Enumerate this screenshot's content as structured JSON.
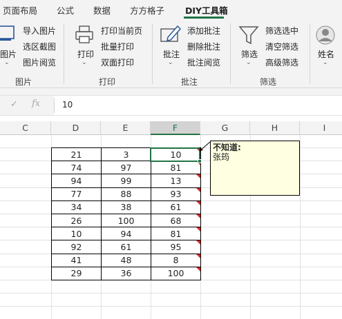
{
  "tabs": [
    {
      "label": "页面布局"
    },
    {
      "label": "公式"
    },
    {
      "label": "数据"
    },
    {
      "label": "方方格子"
    },
    {
      "label": "DIY工具箱",
      "active": true
    }
  ],
  "ribbon": {
    "picture_group": {
      "big_button": "图片",
      "items": [
        "导入图片",
        "选区截图",
        "图片阅览"
      ],
      "label": "图片"
    },
    "print_group": {
      "big_button": "打印",
      "items": [
        "打印当前页",
        "批量打印",
        "双面打印"
      ],
      "label": "打印"
    },
    "comment_group": {
      "big_button": "批注",
      "items": [
        "添加批注",
        "删除批注",
        "批注阅览"
      ],
      "label": "批注"
    },
    "filter_group": {
      "big_button": "筛选",
      "items": [
        "筛选选中",
        "清空筛选",
        "高级筛选"
      ],
      "label": "筛选"
    },
    "name_group": {
      "big_button": "姓名"
    }
  },
  "formula_bar": {
    "value": "10",
    "fx_label": "fx"
  },
  "columns": [
    "C",
    "D",
    "E",
    "F",
    "G",
    "H",
    "I"
  ],
  "selected_column": "F",
  "table": {
    "rows": [
      [
        21,
        3,
        10
      ],
      [
        74,
        97,
        81
      ],
      [
        94,
        99,
        13
      ],
      [
        77,
        88,
        93
      ],
      [
        34,
        38,
        61
      ],
      [
        26,
        100,
        68
      ],
      [
        10,
        94,
        81
      ],
      [
        92,
        61,
        95
      ],
      [
        41,
        48,
        8
      ],
      [
        29,
        36,
        100
      ]
    ]
  },
  "comment": {
    "author": "不知道:",
    "text": "张筠"
  },
  "colors": {
    "accent": "#217346",
    "comment_bg": "#ffffe1",
    "comment_marker": "#e02020"
  }
}
